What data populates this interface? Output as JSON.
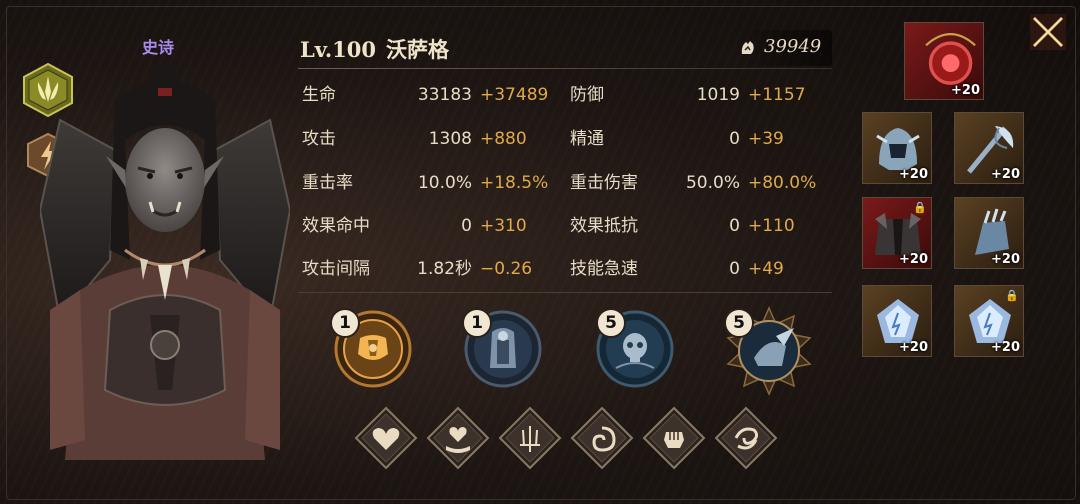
{
  "hero": {
    "rarity": "史诗",
    "level": "Lv.100",
    "name": "沃萨格",
    "power": "39949"
  },
  "stats": [
    {
      "label": "生命",
      "base": "33183",
      "bonus": "+37489"
    },
    {
      "label": "防御",
      "base": "1019",
      "bonus": "+1157"
    },
    {
      "label": "攻击",
      "base": "1308",
      "bonus": "+880"
    },
    {
      "label": "精通",
      "base": "0",
      "bonus": "+39"
    },
    {
      "label": "重击率",
      "base": "10.0%",
      "bonus": "+18.5%"
    },
    {
      "label": "重击伤害",
      "base": "50.0%",
      "bonus": "+80.0%"
    },
    {
      "label": "效果命中",
      "base": "0",
      "bonus": "+310"
    },
    {
      "label": "效果抵抗",
      "base": "0",
      "bonus": "+110"
    },
    {
      "label": "攻击间隔",
      "base": "1.82秒",
      "bonus": "−0.26"
    },
    {
      "label": "技能急速",
      "base": "0",
      "bonus": "+49"
    }
  ],
  "skills": [
    {
      "level": "1",
      "icon": "armor-torso-icon"
    },
    {
      "level": "1",
      "icon": "hooded-shield-icon"
    },
    {
      "level": "5",
      "icon": "skull-icon"
    },
    {
      "level": "5",
      "icon": "horned-helm-icon"
    }
  ],
  "runes": [
    {
      "icon": "heart-icon"
    },
    {
      "icon": "heart-hand-icon"
    },
    {
      "icon": "trident-icon"
    },
    {
      "icon": "swirl-icon"
    },
    {
      "icon": "fist-icon"
    },
    {
      "icon": "vortex-icon"
    }
  ],
  "gear": [
    {
      "slot": "amulet",
      "plus": "+20",
      "locked": false
    },
    {
      "slot": "helmet",
      "plus": "+20",
      "locked": false
    },
    {
      "slot": "weapon",
      "plus": "+20",
      "locked": false
    },
    {
      "slot": "armor",
      "plus": "+20",
      "locked": true
    },
    {
      "slot": "gauntlet",
      "plus": "+20",
      "locked": false
    },
    {
      "slot": "gem-1",
      "plus": "+20",
      "locked": false
    },
    {
      "slot": "gem-2",
      "plus": "+20",
      "locked": true
    }
  ],
  "colors": {
    "bonus": "#e0a94a",
    "rarity": "#a98cf0",
    "accent": "#c9a24a"
  }
}
